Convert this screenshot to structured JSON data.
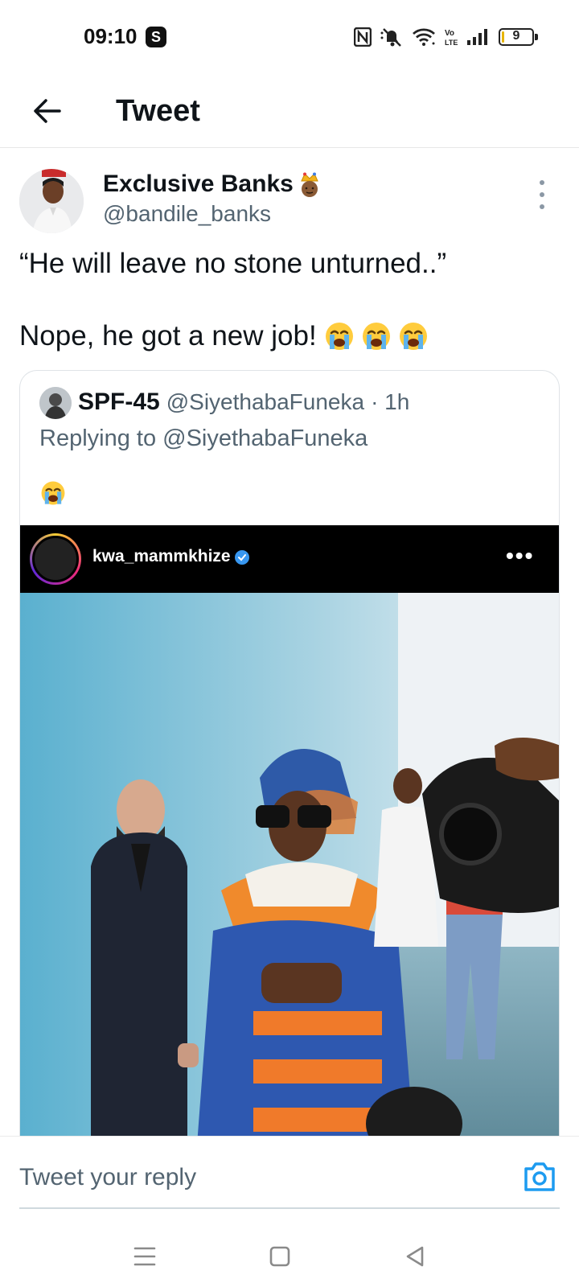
{
  "status_bar": {
    "time": "09:10",
    "notification_badge": "S",
    "battery_level": "9",
    "icons": [
      "nfc-icon",
      "mute-icon",
      "wifi-icon",
      "volte-icon",
      "signal-icon",
      "battery-icon"
    ],
    "battery_color": "#e6b400"
  },
  "header": {
    "title": "Tweet",
    "back_icon": "arrow-left-icon"
  },
  "tweet": {
    "author_name": "Exclusive Banks",
    "author_handle": "@bandile_banks",
    "text_line1": "“He will leave no stone unturned..”",
    "text_line2": "Nope, he got a new job!",
    "emoji_count": 3,
    "quoted": {
      "name": "SPF-45",
      "handle": "@SiyethabaFuneka",
      "time": "· 1h",
      "replying_to": "Replying to @SiyethabaFuneka",
      "media": {
        "ig_username": "kwa_mammkhize",
        "ig_more": "•••"
      }
    }
  },
  "reply_bar": {
    "placeholder": "Tweet your reply",
    "camera_icon": "camera-icon",
    "accent": "#1d9bf0"
  },
  "nav": {
    "items": [
      "menu-nav-icon",
      "home-nav-icon",
      "back-nav-icon"
    ]
  }
}
